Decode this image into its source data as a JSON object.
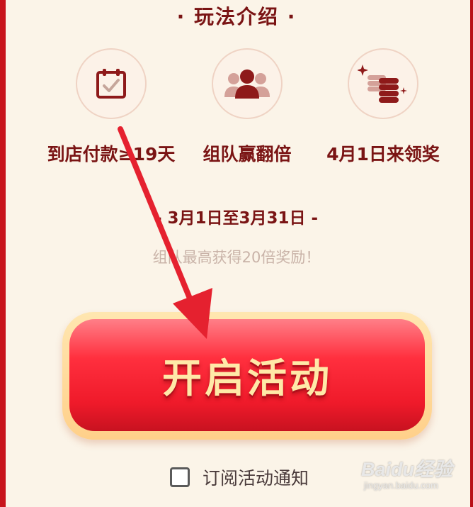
{
  "section": {
    "title": "· 玩法介绍 ·"
  },
  "features": [
    {
      "icon": "calendar-check-icon",
      "label": "到店付款≥19天"
    },
    {
      "icon": "team-icon",
      "label": "组队赢翻倍"
    },
    {
      "icon": "coins-icon",
      "label": "4月1日来领奖"
    }
  ],
  "event": {
    "date_range": "- 3月1日至3月31日 -",
    "subtitle": "组队最高获得20倍奖励！"
  },
  "cta": {
    "label": "开启活动"
  },
  "subscribe": {
    "label": "订阅活动通知",
    "checked": false
  },
  "watermark": {
    "brand": "Baidu经验",
    "url": "jingyan.baidu.com"
  },
  "colors": {
    "brand_red": "#ef1a2a",
    "text_dark_red": "#7a1414",
    "arrow_red": "#e5212f"
  }
}
